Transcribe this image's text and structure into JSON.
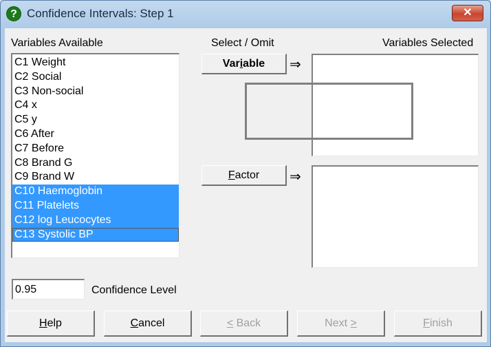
{
  "window": {
    "title": "Confidence Intervals: Step 1",
    "icon": "help-question-icon",
    "close_label": "✕"
  },
  "labels": {
    "variables_available": "Variables Available",
    "select_omit": "Select / Omit",
    "variables_selected": "Variables Selected",
    "confidence_level": "Confidence Level"
  },
  "variables_available": [
    {
      "label": "C1 Weight",
      "selected": false
    },
    {
      "label": "C2 Social",
      "selected": false
    },
    {
      "label": "C3 Non-social",
      "selected": false
    },
    {
      "label": "C4 x",
      "selected": false
    },
    {
      "label": "C5 y",
      "selected": false
    },
    {
      "label": "C6 After",
      "selected": false
    },
    {
      "label": "C7 Before",
      "selected": false
    },
    {
      "label": "C8 Brand G",
      "selected": false
    },
    {
      "label": "C9 Brand W",
      "selected": false
    },
    {
      "label": "C10 Haemoglobin",
      "selected": true
    },
    {
      "label": "C11 Platelets",
      "selected": true
    },
    {
      "label": "C12 log Leucocytes",
      "selected": true
    },
    {
      "label": "C13 Systolic BP",
      "selected": true,
      "focused": true
    }
  ],
  "variables_selected": [],
  "factor_selected": [],
  "buttons": {
    "variable": {
      "pre": "Var",
      "ul": "i",
      "post": "able"
    },
    "factor": {
      "pre": "",
      "ul": "F",
      "post": "actor"
    },
    "help": {
      "pre": "",
      "ul": "H",
      "post": "elp"
    },
    "cancel": {
      "pre": "",
      "ul": "C",
      "post": "ancel"
    },
    "back": {
      "pre": "",
      "ul": "<",
      "post": " Back"
    },
    "next": {
      "pre": "Next ",
      "ul": ">",
      "post": ""
    },
    "finish": {
      "pre": "",
      "ul": "F",
      "post": "inish"
    }
  },
  "arrow_glyph": "⇒",
  "confidence_level_value": "0.95"
}
